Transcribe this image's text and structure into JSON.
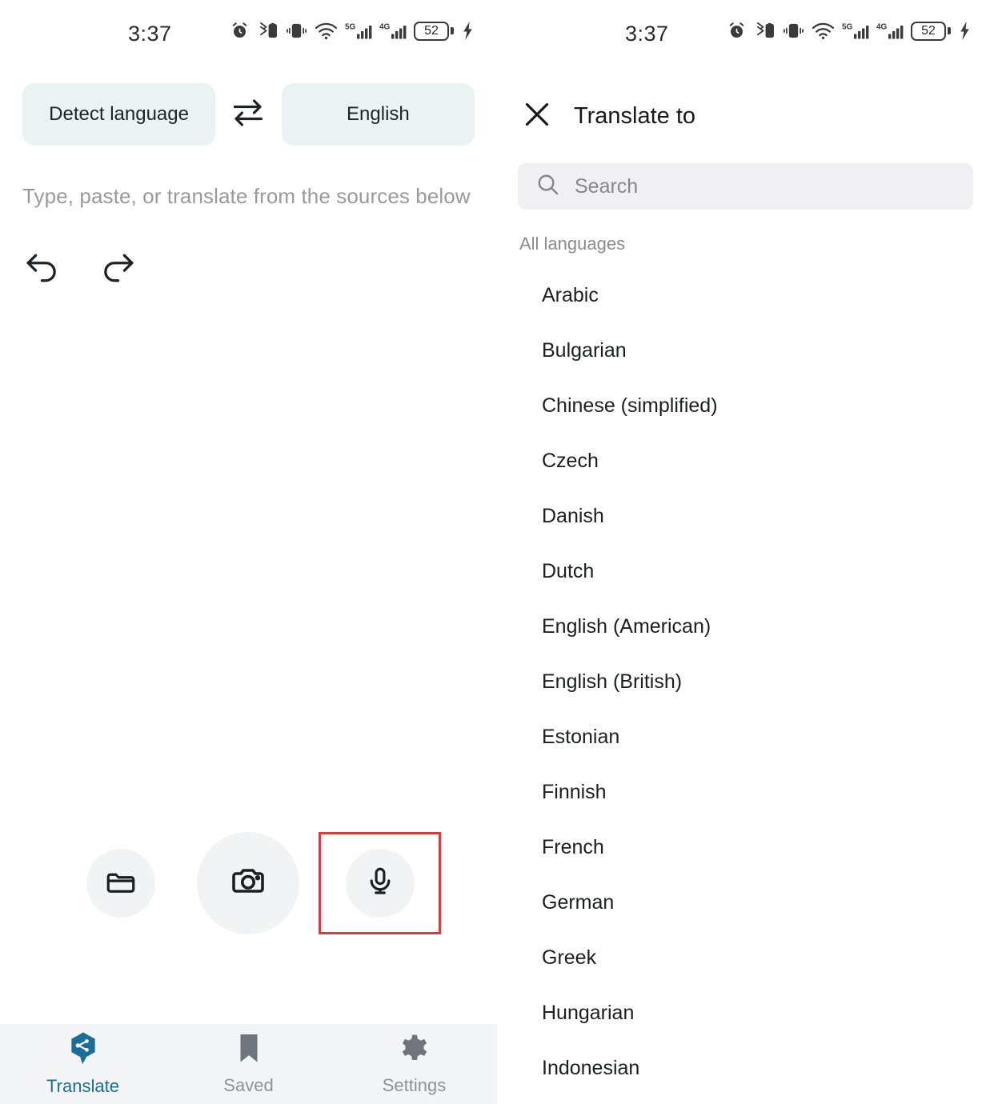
{
  "status_bar": {
    "time": "3:37",
    "battery_percent": "52",
    "icons": [
      "alarm-icon",
      "bluetooth-battery-icon",
      "vibrate-icon",
      "wifi-icon",
      "signal-5g-icon",
      "signal-4g-icon",
      "battery-icon",
      "charging-bolt-icon"
    ]
  },
  "left_screen": {
    "source_language": "Detect language",
    "target_language": "English",
    "swap_icon": "swap-arrows-icon",
    "input_placeholder": "Type, paste, or translate from the sources below",
    "undo_icon": "undo-icon",
    "redo_icon": "redo-icon",
    "actions": [
      {
        "name": "folder",
        "icon": "folder-icon"
      },
      {
        "name": "camera",
        "icon": "camera-icon"
      },
      {
        "name": "microphone",
        "icon": "microphone-icon"
      }
    ],
    "highlight_color": "#d83c3c",
    "nav": [
      {
        "label": "Translate",
        "icon": "translate-icon",
        "active": true
      },
      {
        "label": "Saved",
        "icon": "bookmark-icon",
        "active": false
      },
      {
        "label": "Settings",
        "icon": "gear-icon",
        "active": false
      }
    ],
    "accent_color": "#1a6f96",
    "chip_color": "#eaf2f3"
  },
  "right_screen": {
    "close_icon": "close-icon",
    "title": "Translate to",
    "search": {
      "icon": "search-icon",
      "placeholder": "Search",
      "value": ""
    },
    "section_label": "All languages",
    "languages": [
      "Arabic",
      "Bulgarian",
      "Chinese (simplified)",
      "Czech",
      "Danish",
      "Dutch",
      "English (American)",
      "English (British)",
      "Estonian",
      "Finnish",
      "French",
      "German",
      "Greek",
      "Hungarian",
      "Indonesian"
    ]
  }
}
